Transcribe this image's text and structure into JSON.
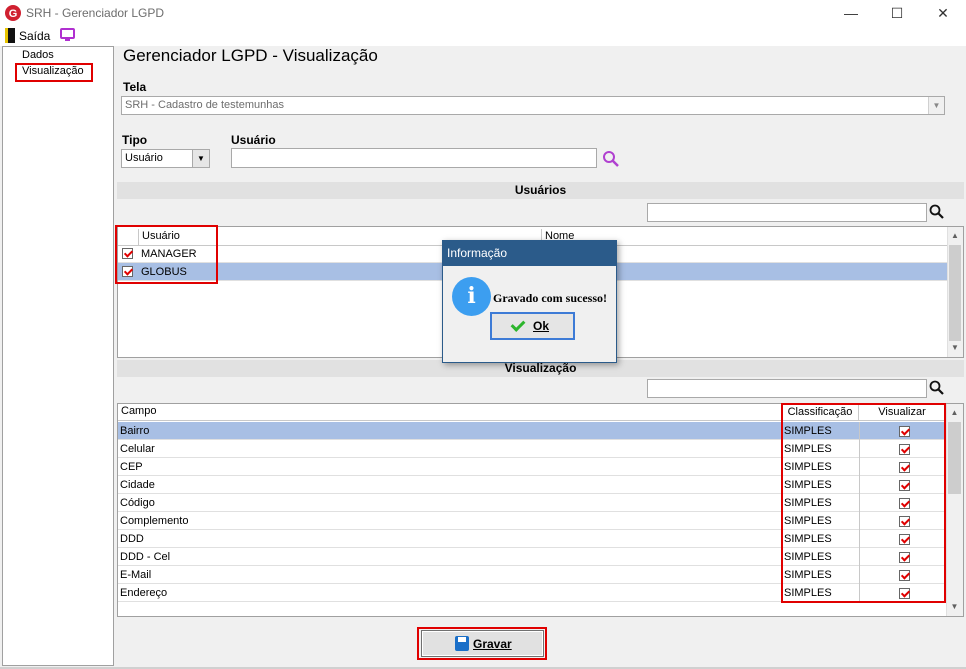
{
  "window": {
    "title": "SRH - Gerenciador LGPD",
    "minimize": "—",
    "maximize": "☐",
    "close": "✕"
  },
  "menu": {
    "exit_label": "Saída"
  },
  "tree": {
    "items": [
      {
        "label": "Dados"
      },
      {
        "label": "Visualização"
      }
    ]
  },
  "main": {
    "title": "Gerenciador LGPD - Visualização",
    "tela_label": "Tela",
    "tela_value": "SRH - Cadastro de testemunhas",
    "tipo_label": "Tipo",
    "tipo_value": "Usuário",
    "usuario_label": "Usuário",
    "usuario_value": ""
  },
  "users_section": {
    "header": "Usuários",
    "filter_value": "",
    "columns": [
      "Usuário",
      "Nome"
    ],
    "rows": [
      {
        "usuario": "MANAGER",
        "checked": true,
        "selected": false
      },
      {
        "usuario": "GLOBUS",
        "checked": true,
        "selected": true
      }
    ]
  },
  "vis_section": {
    "header": "Visualização",
    "filter_value": "",
    "columns": [
      "Campo",
      "Classificação",
      "Visualizar"
    ],
    "rows": [
      {
        "campo": "Bairro",
        "classificacao": "SIMPLES",
        "visualizar": true,
        "selected": true
      },
      {
        "campo": "Celular",
        "classificacao": "SIMPLES",
        "visualizar": true
      },
      {
        "campo": "CEP",
        "classificacao": "SIMPLES",
        "visualizar": true
      },
      {
        "campo": "Cidade",
        "classificacao": "SIMPLES",
        "visualizar": true
      },
      {
        "campo": "Código",
        "classificacao": "SIMPLES",
        "visualizar": true
      },
      {
        "campo": "Complemento",
        "classificacao": "SIMPLES",
        "visualizar": true
      },
      {
        "campo": "DDD",
        "classificacao": "SIMPLES",
        "visualizar": true
      },
      {
        "campo": "DDD - Cel",
        "classificacao": "SIMPLES",
        "visualizar": true
      },
      {
        "campo": "E-Mail",
        "classificacao": "SIMPLES",
        "visualizar": true
      },
      {
        "campo": "Endereço",
        "classificacao": "SIMPLES",
        "visualizar": true
      }
    ]
  },
  "footer": {
    "gravar_label": "Gravar"
  },
  "dialog": {
    "title": "Informação",
    "icon": "i",
    "message": "Gravado com sucesso!",
    "ok_label": "Ok"
  },
  "colors": {
    "highlight": "#e00000",
    "selection": "#a8bfe4",
    "dialog_title": "#2b5b8a"
  }
}
